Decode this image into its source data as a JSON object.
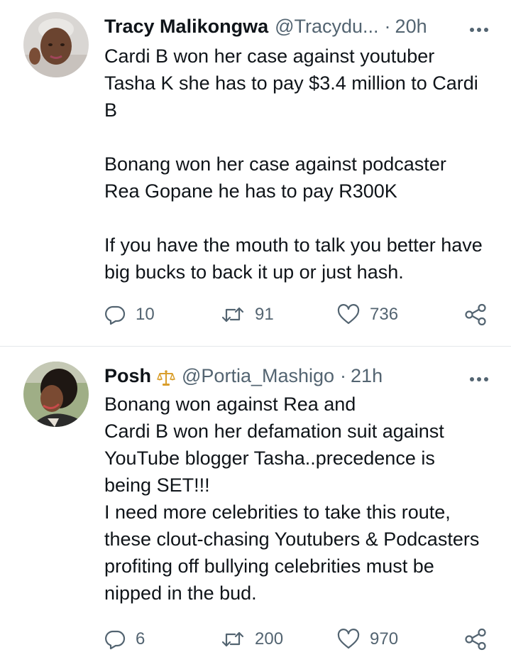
{
  "tweets": [
    {
      "display_name": "Tracy Malikongwa",
      "handle": "@Tracydu...",
      "separator": "·",
      "time": "20h",
      "more_icon": "more-horizontal-icon",
      "paragraphs": [
        "Cardi B won her case against youtuber Tasha K she has to pay $3.4 million to Cardi B",
        "Bonang won her case against podcaster Rea Gopane he has to pay R300K",
        "If you have the mouth to talk you better have big bucks to back it up or just hash."
      ],
      "replies": "10",
      "retweets": "91",
      "likes": "736"
    },
    {
      "display_name": "Posh",
      "badge_icon": "scales-icon",
      "handle": "@Portia_Mashigo",
      "separator": "·",
      "time": "21h",
      "more_icon": "more-horizontal-icon",
      "lines": [
        "Bonang won against Rea and",
        "Cardi B won her defamation suit against YouTube blogger Tasha..precedence is being SET!!!",
        "I need more celebrities to take this route, these clout-chasing Youtubers & Podcasters profiting off bullying celebrities must be nipped in the bud."
      ],
      "replies": "6",
      "retweets": "200",
      "likes": "970"
    }
  ],
  "colors": {
    "text_primary": "#0f1419",
    "text_secondary": "#536471",
    "divider": "#e4e8eb",
    "badge_gold": "#d99e2b"
  }
}
